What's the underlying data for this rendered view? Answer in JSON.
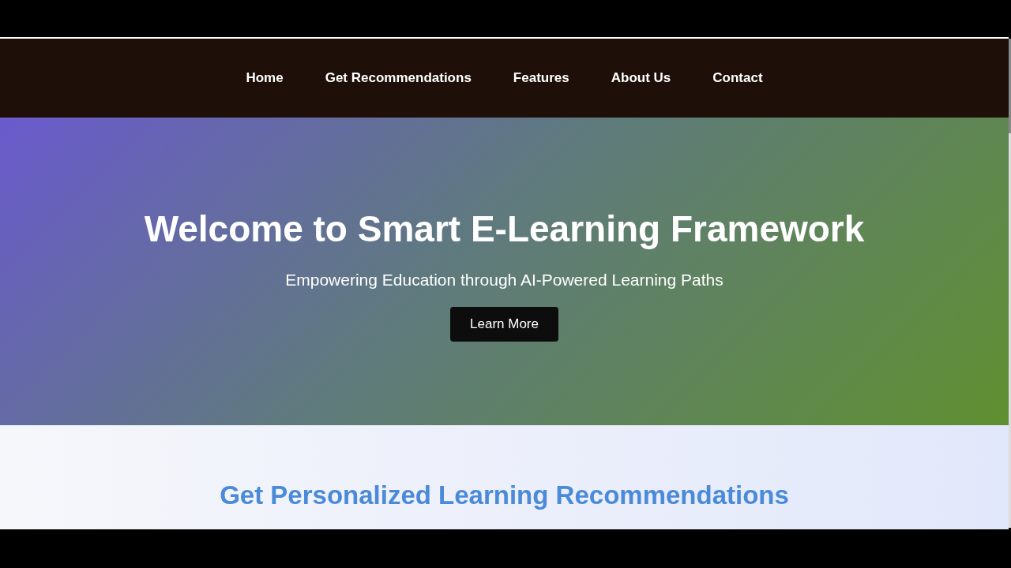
{
  "nav": {
    "links": [
      {
        "label": "Home"
      },
      {
        "label": "Get Recommendations"
      },
      {
        "label": "Features"
      },
      {
        "label": "About Us"
      },
      {
        "label": "Contact"
      }
    ]
  },
  "hero": {
    "title": "Welcome to Smart E-Learning Framework",
    "subtitle": "Empowering Education through AI-Powered Learning Paths",
    "button": "Learn More"
  },
  "recommendations": {
    "heading": "Get Personalized Learning Recommendations"
  }
}
